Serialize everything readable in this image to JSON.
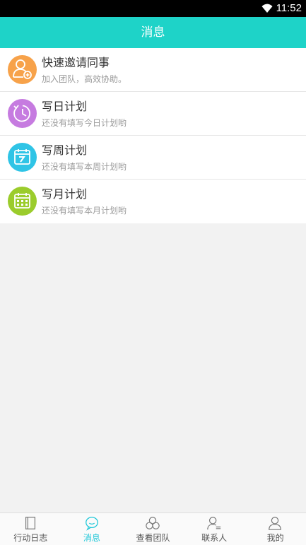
{
  "status_bar": {
    "time": "11:52"
  },
  "header": {
    "title": "消息"
  },
  "list": [
    {
      "title": "快速邀请同事",
      "subtitle": "加入团队，高效协助。",
      "icon": "invite-colleague-icon",
      "color": "#f7a24a"
    },
    {
      "title": "写日计划",
      "subtitle": "还没有填写今日计划哟",
      "icon": "clock-icon",
      "color": "#c67be0"
    },
    {
      "title": "写周计划",
      "subtitle": "还没有填写本周计划哟",
      "icon": "week-calendar-icon",
      "color": "#2fc4e6"
    },
    {
      "title": "写月计划",
      "subtitle": "还没有填写本月计划哟",
      "icon": "month-calendar-icon",
      "color": "#9bcc2c"
    }
  ],
  "tabs": [
    {
      "label": "行动日志",
      "icon": "notebook-icon",
      "active": false
    },
    {
      "label": "消息",
      "icon": "message-icon",
      "active": true
    },
    {
      "label": "查看团队",
      "icon": "team-icon",
      "active": false
    },
    {
      "label": "联系人",
      "icon": "contacts-icon",
      "active": false
    },
    {
      "label": "我的",
      "icon": "profile-icon",
      "active": false
    }
  ],
  "colors": {
    "accent": "#1ed3c8",
    "tab_active": "#1ec7d8"
  }
}
